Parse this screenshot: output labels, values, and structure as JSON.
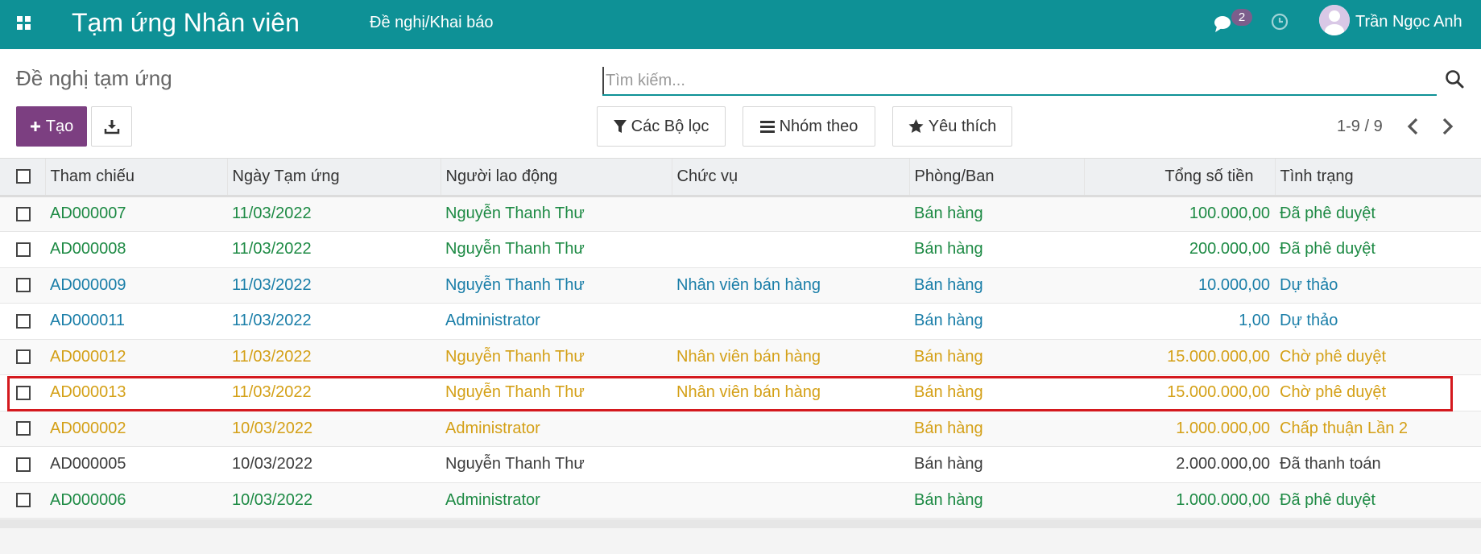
{
  "navbar": {
    "app_title": "Tạm ứng Nhân viên",
    "menu_item": "Đề nghị/Khai báo",
    "chat_count": "2",
    "user_name": "Trần Ngọc Anh",
    "bg_color": "#0e9196"
  },
  "control": {
    "breadcrumb": "Đề nghị tạm ứng",
    "search_placeholder": "Tìm kiếm...",
    "create_label": "Tạo",
    "filter_label": "Các Bộ lọc",
    "groupby_label": "Nhóm theo",
    "favorites_label": "Yêu thích",
    "pager": "1-9 / 9"
  },
  "table": {
    "columns": [
      "Tham chiếu",
      "Ngày Tạm ứng",
      "Người lao động",
      "Chức vụ",
      "Phòng/Ban",
      "Tổng số tiền",
      "Tình trạng"
    ],
    "rows": [
      {
        "ref": "AD000007",
        "date": "11/03/2022",
        "employee": "Nguyễn Thanh Thư",
        "position": "",
        "department": "Bán hàng",
        "amount": "100.000,00",
        "status": "Đã phê duyệt",
        "state": "approved"
      },
      {
        "ref": "AD000008",
        "date": "11/03/2022",
        "employee": "Nguyễn Thanh Thư",
        "position": "",
        "department": "Bán hàng",
        "amount": "200.000,00",
        "status": "Đã phê duyệt",
        "state": "approved"
      },
      {
        "ref": "AD000009",
        "date": "11/03/2022",
        "employee": "Nguyễn Thanh Thư",
        "position": "Nhân viên bán hàng",
        "department": "Bán hàng",
        "amount": "10.000,00",
        "status": "Dự thảo",
        "state": "draft"
      },
      {
        "ref": "AD000011",
        "date": "11/03/2022",
        "employee": "Administrator",
        "position": "",
        "department": "Bán hàng",
        "amount": "1,00",
        "status": "Dự thảo",
        "state": "draft"
      },
      {
        "ref": "AD000012",
        "date": "11/03/2022",
        "employee": "Nguyễn Thanh Thư",
        "position": "Nhân viên bán hàng",
        "department": "Bán hàng",
        "amount": "15.000.000,00",
        "status": "Chờ phê duyệt",
        "state": "pending"
      },
      {
        "ref": "AD000013",
        "date": "11/03/2022",
        "employee": "Nguyễn Thanh Thư",
        "position": "Nhân viên bán hàng",
        "department": "Bán hàng",
        "amount": "15.000.000,00",
        "status": "Chờ phê duyệt",
        "state": "pending"
      },
      {
        "ref": "AD000002",
        "date": "10/03/2022",
        "employee": "Administrator",
        "position": "",
        "department": "Bán hàng",
        "amount": "1.000.000,00",
        "status": "Chấp thuận Lần 2",
        "state": "pending"
      },
      {
        "ref": "AD000005",
        "date": "10/03/2022",
        "employee": "Nguyễn Thanh Thư",
        "position": "",
        "department": "Bán hàng",
        "amount": "2.000.000,00",
        "status": "Đã thanh toán",
        "state": "done"
      },
      {
        "ref": "AD000006",
        "date": "10/03/2022",
        "employee": "Administrator",
        "position": "",
        "department": "Bán hàng",
        "amount": "1.000.000,00",
        "status": "Đã phê duyệt",
        "state": "approved"
      }
    ]
  },
  "colors": {
    "approved": "#1d8a44",
    "draft": "#1a7ea8",
    "pending": "#d4a017",
    "done": "#3d3d3d",
    "primary_button": "#7c3f81",
    "highlight": "#d4191e"
  }
}
